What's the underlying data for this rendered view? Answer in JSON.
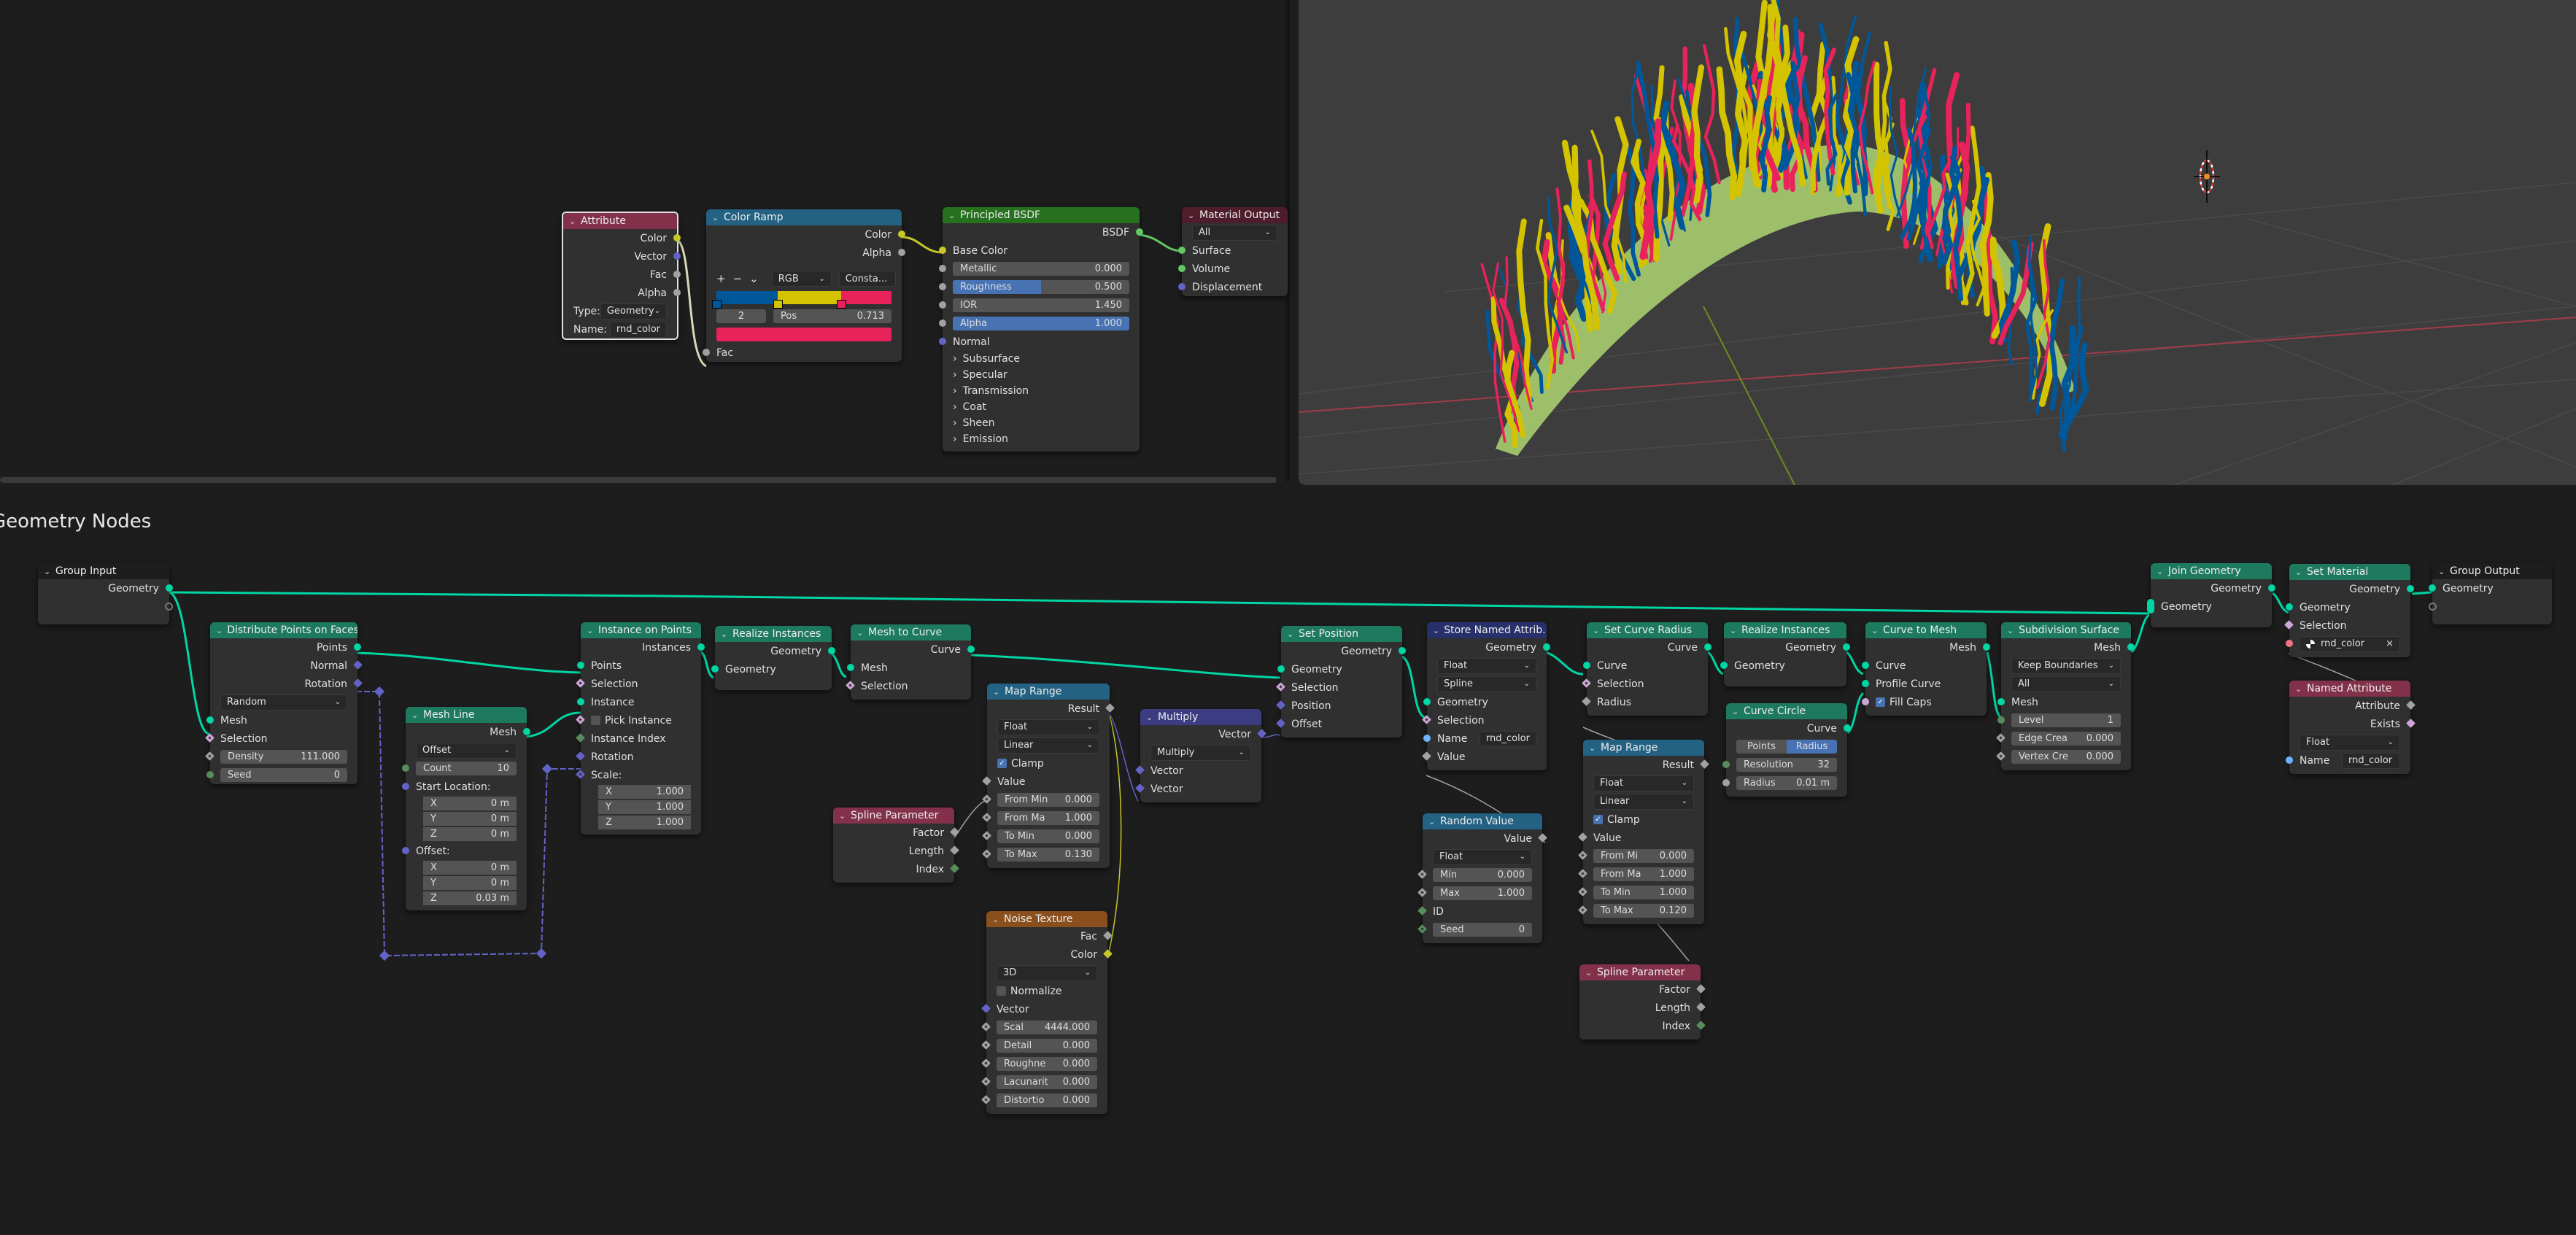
{
  "colors": {
    "geometry": "#00d6a3",
    "vector": "#6363c7",
    "float": "#a1a1a1",
    "integer": "#598c5c",
    "boolean": "#cca6d6",
    "color": "#c7c729",
    "string": "#70b2ff",
    "material": "#eb7582",
    "shader": "#63c763",
    "ramp_blue": "#00579a",
    "ramp_yellow": "#d4c300",
    "ramp_pink": "#e8225a",
    "mesh_green": "#9dbf6a"
  },
  "geometry_editor": {
    "title": "Geometry Nodes"
  },
  "shader": {
    "attribute": {
      "title": "Attribute",
      "outputs": [
        "Color",
        "Vector",
        "Fac",
        "Alpha"
      ],
      "type_label": "Type:",
      "type_value": "Geometry",
      "name_label": "Name:",
      "name_value": "rnd_color"
    },
    "color_ramp": {
      "title": "Color Ramp",
      "outputs": [
        "Color",
        "Alpha"
      ],
      "add": "+",
      "remove": "−",
      "menu": "⌄",
      "color_mode": "RGB",
      "interpolation": "Consta...",
      "stop_index": "2",
      "pos_label": "Pos",
      "pos_value": "0.713",
      "stops": [
        {
          "pos": 0.0,
          "color": "#00579a"
        },
        {
          "pos": 0.35,
          "color": "#d4c300"
        },
        {
          "pos": 0.713,
          "color": "#e8225a"
        }
      ],
      "input": "Fac"
    },
    "principled": {
      "title": "Principled BSDF",
      "output": "BSDF",
      "base_color": "Base Color",
      "fields": [
        {
          "label": "Metallic",
          "value": "0.000",
          "fill": 0
        },
        {
          "label": "Roughness",
          "value": "0.500",
          "fill": 0.5
        },
        {
          "label": "IOR",
          "value": "1.450",
          "fill": 0
        },
        {
          "label": "Alpha",
          "value": "1.000",
          "fill": 1
        }
      ],
      "normal": "Normal",
      "panels": [
        "Subsurface",
        "Specular",
        "Transmission",
        "Coat",
        "Sheen",
        "Emission"
      ]
    },
    "material_output": {
      "title": "Material Output",
      "target": "All",
      "inputs": [
        "Surface",
        "Volume",
        "Displacement"
      ]
    }
  },
  "geo": {
    "group_input": {
      "title": "Group Input",
      "output": "Geometry"
    },
    "distribute": {
      "title": "Distribute Points on Faces",
      "outputs": [
        "Points",
        "Normal",
        "Rotation"
      ],
      "mode": "Random",
      "inputs": [
        "Mesh",
        "Selection"
      ],
      "density_label": "Density",
      "density": "111.000",
      "seed_label": "Seed",
      "seed": "0"
    },
    "mesh_line": {
      "title": "Mesh Line",
      "output": "Mesh",
      "mode": "Offset",
      "count_label": "Count",
      "count": "10",
      "start_label": "Start Location:",
      "start": [
        {
          "a": "X",
          "v": "0 m"
        },
        {
          "a": "Y",
          "v": "0 m"
        },
        {
          "a": "Z",
          "v": "0 m"
        }
      ],
      "offset_label": "Offset:",
      "offset": [
        {
          "a": "X",
          "v": "0 m"
        },
        {
          "a": "Y",
          "v": "0 m"
        },
        {
          "a": "Z",
          "v": "0.03 m"
        }
      ]
    },
    "instance_on_points": {
      "title": "Instance on Points",
      "output": "Instances",
      "inputs": [
        "Points",
        "Selection",
        "Instance",
        "Pick Instance",
        "Instance Index",
        "Rotation",
        "Scale:"
      ],
      "scale": [
        {
          "a": "X",
          "v": "1.000"
        },
        {
          "a": "Y",
          "v": "1.000"
        },
        {
          "a": "Z",
          "v": "1.000"
        }
      ]
    },
    "realize1": {
      "title": "Realize Instances",
      "output": "Geometry",
      "input": "Geometry"
    },
    "mesh_to_curve": {
      "title": "Mesh to Curve",
      "output": "Curve",
      "inputs": [
        "Mesh",
        "Selection"
      ]
    },
    "spline_param1": {
      "title": "Spline Parameter",
      "outputs": [
        "Factor",
        "Length",
        "Index"
      ]
    },
    "map_range1": {
      "title": "Map Range",
      "output": "Result",
      "type": "Float",
      "interp": "Linear",
      "clamp": "Clamp",
      "value": "Value",
      "fields": [
        {
          "label": "From Min",
          "value": "0.000"
        },
        {
          "label": "From Ma",
          "value": "1.000"
        },
        {
          "label": "To Min",
          "value": "0.000"
        },
        {
          "label": "To Max",
          "value": "0.130"
        }
      ]
    },
    "multiply": {
      "title": "Multiply",
      "output": "Vector",
      "op": "Multiply",
      "inputs": [
        "Vector",
        "Vector"
      ]
    },
    "noise": {
      "title": "Noise Texture",
      "outputs": [
        "Fac",
        "Color"
      ],
      "dims": "3D",
      "normalize": "Normalize",
      "vector": "Vector",
      "fields": [
        {
          "label": "Scal",
          "value": "4444.000"
        },
        {
          "label": "Detail",
          "value": "0.000"
        },
        {
          "label": "Roughne",
          "value": "0.000"
        },
        {
          "label": "Lacunarit",
          "value": "0.000"
        },
        {
          "label": "Distortio",
          "value": "0.000"
        }
      ]
    },
    "set_position": {
      "title": "Set Position",
      "output": "Geometry",
      "inputs": [
        "Geometry",
        "Selection",
        "Position",
        "Offset"
      ]
    },
    "store_named": {
      "title": "Store Named Attrib...",
      "output": "Geometry",
      "type": "Float",
      "domain": "Spline",
      "inputs": [
        "Geometry",
        "Selection"
      ],
      "name_label": "Name",
      "name_value": "rnd_color",
      "value": "Value"
    },
    "random_value": {
      "title": "Random Value",
      "output": "Value",
      "type": "Float",
      "min_label": "Min",
      "min": "0.000",
      "max_label": "Max",
      "max": "1.000",
      "id": "ID",
      "seed_label": "Seed",
      "seed": "0"
    },
    "set_curve_radius": {
      "title": "Set Curve Radius",
      "output": "Curve",
      "inputs": [
        "Curve",
        "Selection",
        "Radius"
      ]
    },
    "map_range2": {
      "title": "Map Range",
      "output": "Result",
      "type": "Float",
      "interp": "Linear",
      "clamp": "Clamp",
      "value": "Value",
      "fields": [
        {
          "label": "From Mi",
          "value": "0.000"
        },
        {
          "label": "From Ma",
          "value": "1.000"
        },
        {
          "label": "To Min",
          "value": "1.000"
        },
        {
          "label": "To Max",
          "value": "0.120"
        }
      ]
    },
    "spline_param2": {
      "title": "Spline Parameter",
      "outputs": [
        "Factor",
        "Length",
        "Index"
      ]
    },
    "realize2": {
      "title": "Realize Instances",
      "output": "Geometry",
      "input": "Geometry"
    },
    "curve_circle": {
      "title": "Curve Circle",
      "output": "Curve",
      "mode_a": "Points",
      "mode_b": "Radius",
      "res_label": "Resolution",
      "res": "32",
      "radius_label": "Radius",
      "radius": "0.01 m"
    },
    "curve_to_mesh": {
      "title": "Curve to Mesh",
      "output": "Mesh",
      "inputs": [
        "Curve",
        "Profile Curve"
      ],
      "fill_caps": "Fill Caps"
    },
    "subdiv": {
      "title": "Subdivision Surface",
      "output": "Mesh",
      "uv_smooth": "Keep Boundaries",
      "boundary": "All",
      "input": "Mesh",
      "fields": [
        {
          "label": "Level",
          "value": "1"
        },
        {
          "label": "Edge Crea",
          "value": "0.000"
        },
        {
          "label": "Vertex Cre",
          "value": "0.000"
        }
      ]
    },
    "join": {
      "title": "Join Geometry",
      "output": "Geometry",
      "input": "Geometry"
    },
    "set_material": {
      "title": "Set Material",
      "output": "Geometry",
      "inputs": [
        "Geometry",
        "Selection"
      ],
      "material": "rnd_color",
      "clear": "×"
    },
    "named_attr": {
      "title": "Named Attribute",
      "outputs": [
        "Attribute",
        "Exists"
      ],
      "type": "Float",
      "name_label": "Name",
      "name_value": "rnd_color"
    },
    "group_output": {
      "title": "Group Output",
      "input": "Geometry"
    }
  }
}
